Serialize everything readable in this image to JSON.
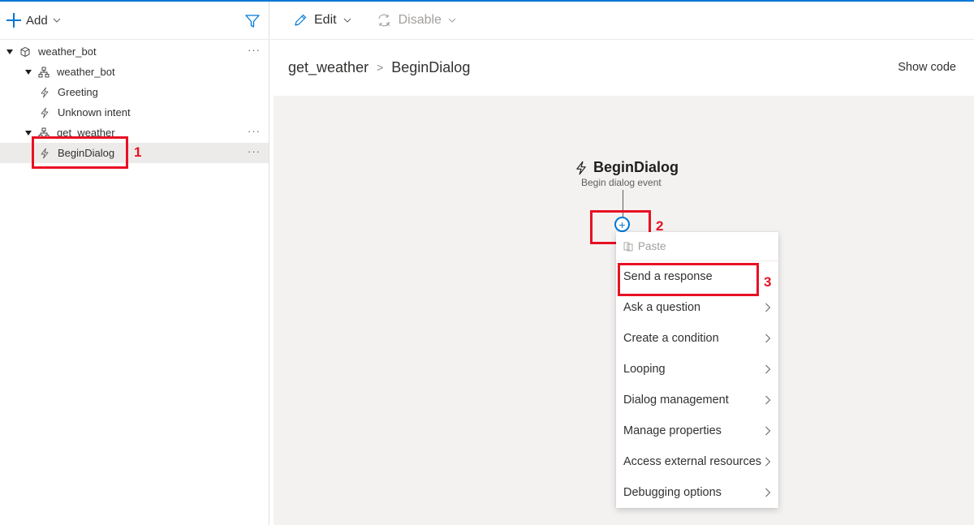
{
  "colors": {
    "accent": "#0078d4",
    "annotation": "#e81123",
    "selected_bg": "#edebe9",
    "canvas_bg": "#f3f2f1"
  },
  "left_panel": {
    "add_label": "Add",
    "add_icon": "plus-icon",
    "filter_icon": "filter-icon",
    "tree": [
      {
        "label": "weather_bot",
        "icon": "bot-cube-icon",
        "expanded": true,
        "more": "···"
      },
      {
        "label": "weather_bot",
        "icon": "dialog-hierarchy-icon",
        "expanded": true,
        "more": ""
      },
      {
        "label": "Greeting",
        "icon": "trigger-lightning-icon",
        "more": ""
      },
      {
        "label": "Unknown intent",
        "icon": "trigger-lightning-icon",
        "more": ""
      },
      {
        "label": "get_weather",
        "icon": "dialog-hierarchy-icon",
        "expanded": true,
        "more": "···"
      },
      {
        "label": "BeginDialog",
        "icon": "trigger-lightning-icon",
        "selected": true,
        "more": "···"
      }
    ]
  },
  "toolbar": {
    "edit_label": "Edit",
    "edit_icon": "pencil-icon",
    "disable_label": "Disable",
    "disable_icon": "refresh-disable-icon"
  },
  "header": {
    "breadcrumb": [
      "get_weather",
      "BeginDialog"
    ],
    "breadcrumb_separator": ">",
    "show_code": "Show code"
  },
  "canvas": {
    "node_title": "BeginDialog",
    "node_subtitle": "Begin dialog event",
    "add_button": "+"
  },
  "menu": {
    "paste_label": "Paste",
    "items": [
      {
        "label": "Send a response",
        "has_submenu": false
      },
      {
        "label": "Ask a question",
        "has_submenu": true
      },
      {
        "label": "Create a condition",
        "has_submenu": true
      },
      {
        "label": "Looping",
        "has_submenu": true
      },
      {
        "label": "Dialog management",
        "has_submenu": true
      },
      {
        "label": "Manage properties",
        "has_submenu": true
      },
      {
        "label": "Access external resources",
        "has_submenu": true
      },
      {
        "label": "Debugging options",
        "has_submenu": true
      }
    ]
  },
  "annotations": [
    "1",
    "2",
    "3"
  ]
}
